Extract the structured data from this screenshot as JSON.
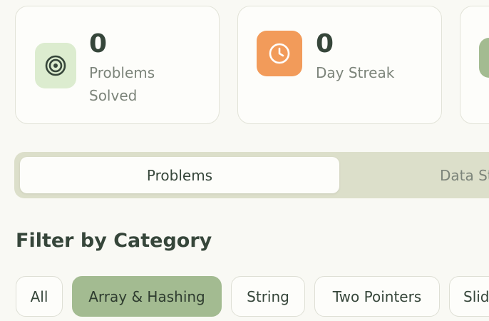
{
  "colors": {
    "background": "#f9f9f4",
    "card": "#fdfdfa",
    "accent_green": "#a3bb91",
    "accent_green_light": "#dceccf",
    "accent_orange": "#f29b5a",
    "text_dark": "#36463a",
    "text_muted": "#7c847a"
  },
  "stats": [
    {
      "value": "0",
      "label_line1": "Problems",
      "label_line2": "Solved",
      "icon": "target-icon"
    },
    {
      "value": "0",
      "label_line1": "Day Streak",
      "label_line2": "",
      "icon": "clock-icon"
    }
  ],
  "tabs": [
    {
      "label": "Problems",
      "active": true
    },
    {
      "label": "Data Structures",
      "active": false
    }
  ],
  "filter": {
    "title": "Filter by Category",
    "chips": [
      {
        "label": "All",
        "active": false
      },
      {
        "label": "Array & Hashing",
        "active": true
      },
      {
        "label": "String",
        "active": false
      },
      {
        "label": "Two Pointers",
        "active": false
      },
      {
        "label": "Sliding Window",
        "active": false
      }
    ]
  }
}
